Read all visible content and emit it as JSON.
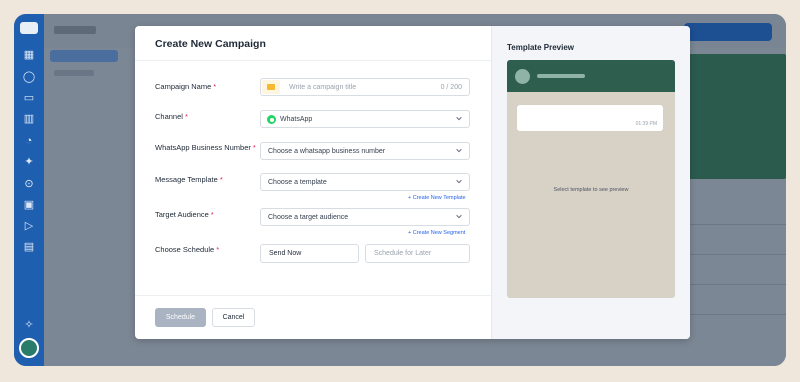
{
  "modal": {
    "title": "Create New Campaign",
    "fields": {
      "campaign_name": {
        "label": "Campaign Name",
        "placeholder": "Write a campaign title",
        "counter": "0 / 200"
      },
      "channel": {
        "label": "Channel",
        "value": "WhatsApp"
      },
      "business_number": {
        "label": "WhatsApp Business Number",
        "placeholder": "Choose a whatsapp business number"
      },
      "message_template": {
        "label": "Message Template",
        "placeholder": "Choose a template",
        "link": "+ Create New Template"
      },
      "target_audience": {
        "label": "Target Audience",
        "placeholder": "Choose a target audience",
        "link": "+ Create New Segment"
      },
      "schedule": {
        "label": "Choose Schedule",
        "send_now": "Send Now",
        "schedule_later": "Schedule for Later"
      }
    },
    "required_mark": "*",
    "footer": {
      "schedule_button": "Schedule",
      "cancel_button": "Cancel"
    }
  },
  "preview": {
    "title": "Template Preview",
    "bubble_time": "01:39 PM",
    "empty_text": "Select template to see preview"
  },
  "colors": {
    "accent": "#1f5fb0",
    "whatsapp_green": "#25d366",
    "whatsapp_header": "#2e5e4e",
    "required": "#e0245e",
    "link": "#2563eb"
  },
  "icons": {
    "campaign_name": "folder-icon",
    "channel": "whatsapp-icon",
    "dropdowns": "chevron-down-icon"
  }
}
